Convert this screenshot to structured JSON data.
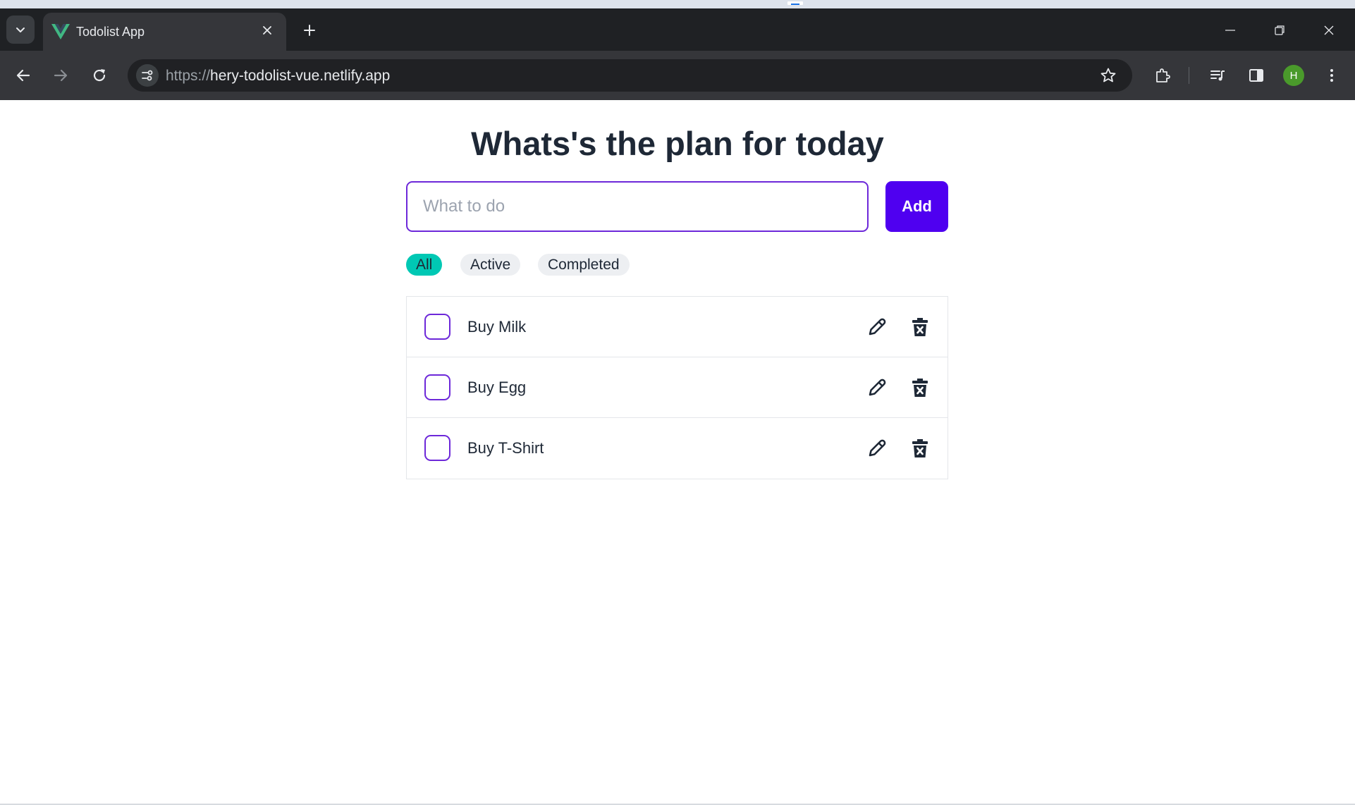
{
  "browser": {
    "tab": {
      "title": "Todolist App"
    },
    "address": {
      "scheme": "https://",
      "host": "hery-todolist-vue.netlify.app"
    },
    "profile_initial": "H"
  },
  "app": {
    "heading": "Whats's the plan for today",
    "input": {
      "placeholder": "What to do",
      "value": ""
    },
    "add_label": "Add",
    "filters": [
      {
        "label": "All",
        "selected": true
      },
      {
        "label": "Active",
        "selected": false
      },
      {
        "label": "Completed",
        "selected": false
      }
    ],
    "todos": [
      {
        "text": "Buy Milk",
        "done": false
      },
      {
        "text": "Buy Egg",
        "done": false
      },
      {
        "text": "Buy T-Shirt",
        "done": false
      }
    ]
  },
  "colors": {
    "accent": "#4f00f0",
    "input_border": "#6d28d9",
    "filter_selected": "#00c8b4",
    "vue_green": "#41b883"
  },
  "icons": [
    "chevron-down-icon",
    "vue-logo-icon",
    "close-icon",
    "plus-icon",
    "minimize-icon",
    "restore-icon",
    "back-icon",
    "forward-icon",
    "reload-icon",
    "site-settings-icon",
    "star-icon",
    "extensions-icon",
    "media-icon",
    "side-panel-icon",
    "menu-icon",
    "pencil-icon",
    "trash-icon"
  ]
}
